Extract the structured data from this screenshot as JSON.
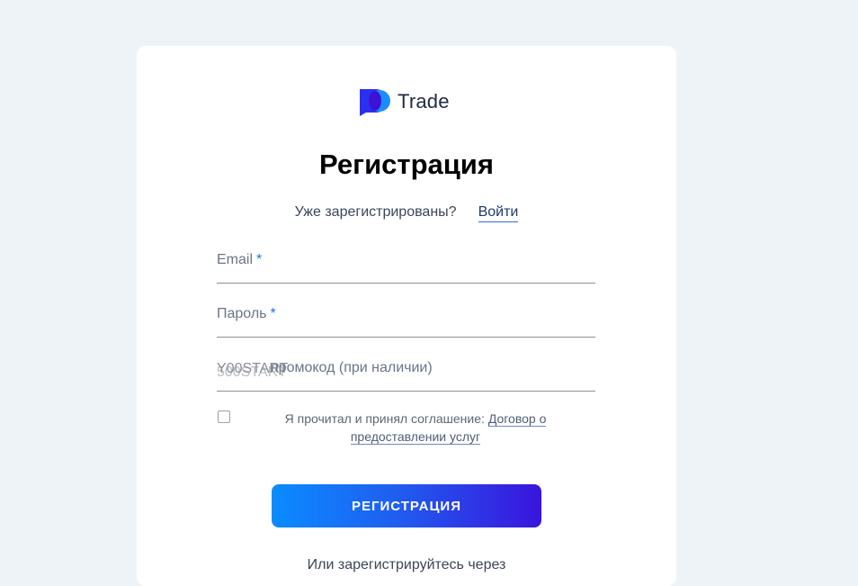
{
  "logo": {
    "text": "Trade",
    "icon": "po-logo-icon"
  },
  "title": "Регистрация",
  "login_prompt": {
    "text": "Уже зарегистрированы?",
    "link": "Войти"
  },
  "form": {
    "email_label": "Email",
    "password_label": "Пароль",
    "required_mark": "*",
    "promo_label": "промокод (при наличии)",
    "promo_value": "Y00START",
    "promo_value_overlay": "500START"
  },
  "agreement": {
    "text": "Я прочитал и принял соглашение:",
    "link": "Договор о предоставлении услуг"
  },
  "submit_label": "РЕГИСТРАЦИЯ",
  "alt_signup": "Или зарегистрируйтесь через",
  "colors": {
    "accent_start": "#0a8cff",
    "accent_end": "#3a14dd",
    "required": "#1a73e8",
    "background": "#eef3f8"
  }
}
